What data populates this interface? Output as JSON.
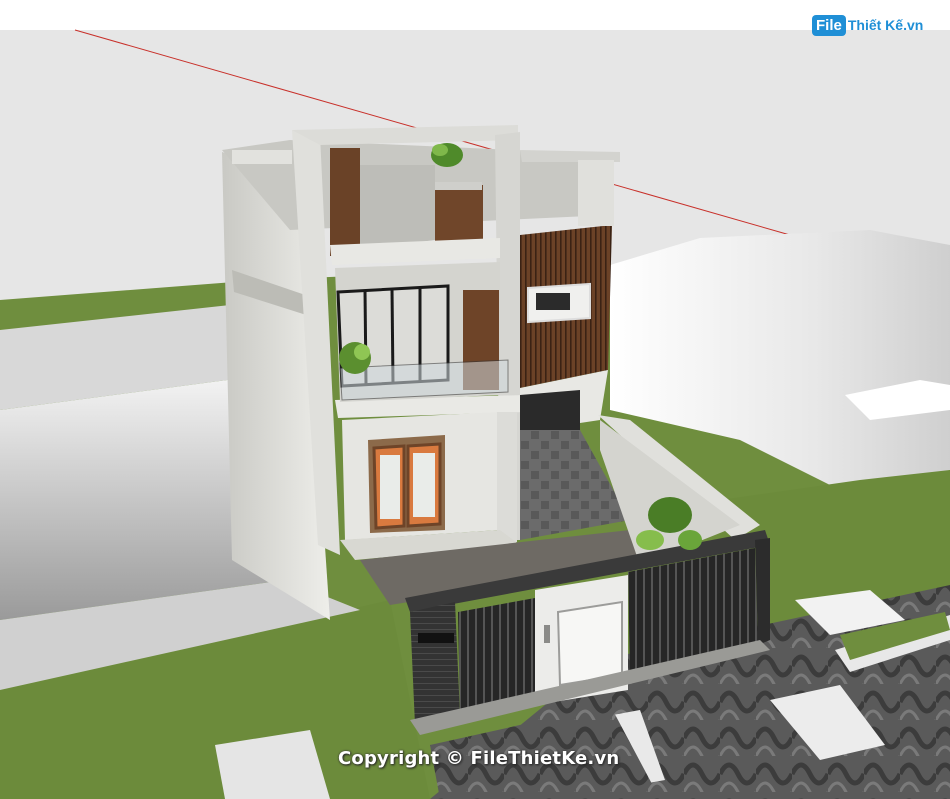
{
  "watermark": {
    "logo_file": "File",
    "logo_name": "Thiết Kế.vn",
    "copyright": "Copyright © FileThietKe.vn"
  },
  "colors": {
    "sky": "#ebebeb",
    "grass": "#6f8e3e",
    "wood": "#6a4227",
    "pavement": "#555555",
    "wall": "#d9d9d5"
  }
}
